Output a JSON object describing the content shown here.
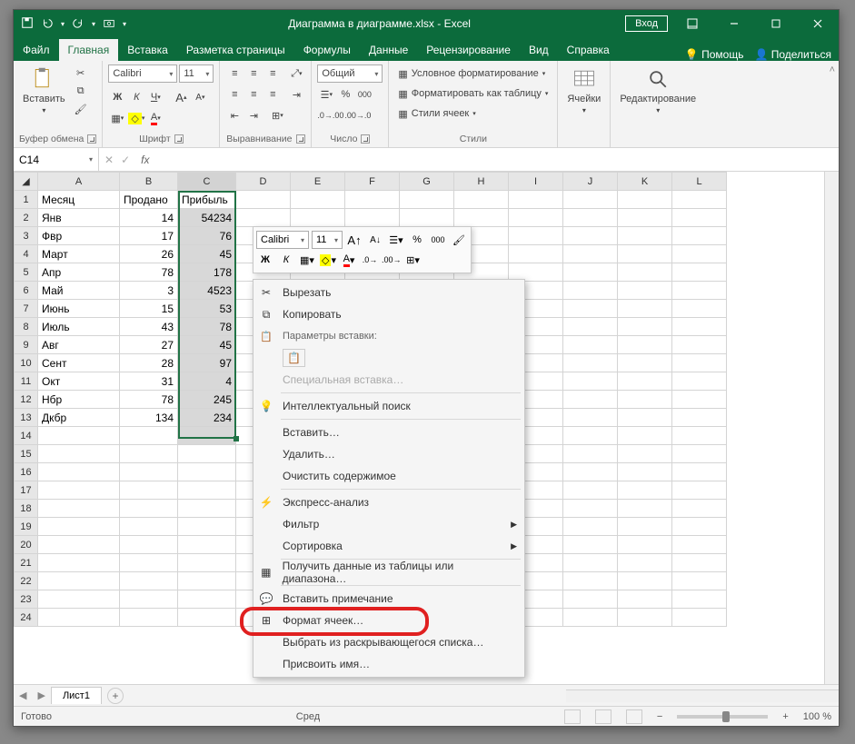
{
  "title": "Диаграмма в диаграмме.xlsx  -  Excel",
  "signin": "Вход",
  "tabs": {
    "file": "Файл",
    "home": "Главная",
    "insert": "Вставка",
    "layout": "Разметка страницы",
    "formulas": "Формулы",
    "data": "Данные",
    "review": "Рецензирование",
    "view": "Вид",
    "help": "Справка",
    "tell": "Помощь",
    "share": "Поделиться"
  },
  "ribbon": {
    "clipboard": {
      "label": "Буфер обмена",
      "paste": "Вставить"
    },
    "font": {
      "label": "Шрифт",
      "name": "Calibri",
      "size": "11",
      "bold": "Ж",
      "italic": "К",
      "underline": "Ч"
    },
    "align": {
      "label": "Выравнивание"
    },
    "number": {
      "label": "Число",
      "format": "Общий"
    },
    "styles": {
      "label": "Стили",
      "cond": "Условное форматирование",
      "table": "Форматировать как таблицу",
      "cell": "Стили ячеек"
    },
    "cells": {
      "label": "Ячейки"
    },
    "editing": {
      "label": "Редактирование"
    }
  },
  "namebox": "C14",
  "columns": [
    "A",
    "B",
    "C",
    "D",
    "E",
    "F",
    "G",
    "H",
    "I",
    "J",
    "K",
    "L"
  ],
  "headers": {
    "a": "Месяц",
    "b": "Продано",
    "c": "Прибыль"
  },
  "rows": [
    {
      "n": "2",
      "a": "Янв",
      "b": "14",
      "c": "54234"
    },
    {
      "n": "3",
      "a": "Фвр",
      "b": "17",
      "c": "76"
    },
    {
      "n": "4",
      "a": "Март",
      "b": "26",
      "c": "45"
    },
    {
      "n": "5",
      "a": "Апр",
      "b": "78",
      "c": "178"
    },
    {
      "n": "6",
      "a": "Май",
      "b": "3",
      "c": "4523"
    },
    {
      "n": "7",
      "a": "Июнь",
      "b": "15",
      "c": "53"
    },
    {
      "n": "8",
      "a": "Июль",
      "b": "43",
      "c": "78"
    },
    {
      "n": "9",
      "a": "Авг",
      "b": "27",
      "c": "45"
    },
    {
      "n": "10",
      "a": "Сент",
      "b": "28",
      "c": "97"
    },
    {
      "n": "11",
      "a": "Окт",
      "b": "31",
      "c": "4"
    },
    {
      "n": "12",
      "a": "Нбр",
      "b": "78",
      "c": "245"
    },
    {
      "n": "13",
      "a": "Дкбр",
      "b": "134",
      "c": "234"
    }
  ],
  "mini": {
    "font": "Calibri",
    "size": "11",
    "bold": "Ж",
    "italic": "К"
  },
  "ctx": {
    "cut": "Вырезать",
    "copy": "Копировать",
    "paste_header": "Параметры вставки:",
    "paste_special": "Специальная вставка…",
    "smart_lookup": "Интеллектуальный поиск",
    "insert": "Вставить…",
    "delete": "Удалить…",
    "clear": "Очистить содержимое",
    "quick": "Экспресс-анализ",
    "filter": "Фильтр",
    "sort": "Сортировка",
    "get_data": "Получить данные из таблицы или диапазона…",
    "comment": "Вставить примечание",
    "format_cells": "Формат ячеек…",
    "dropdown": "Выбрать из раскрывающегося списка…",
    "name": "Присвоить имя…"
  },
  "sheet_tab": "Лист1",
  "status": {
    "ready": "Готово",
    "avg": "Сред",
    "zoom": "100 %"
  }
}
